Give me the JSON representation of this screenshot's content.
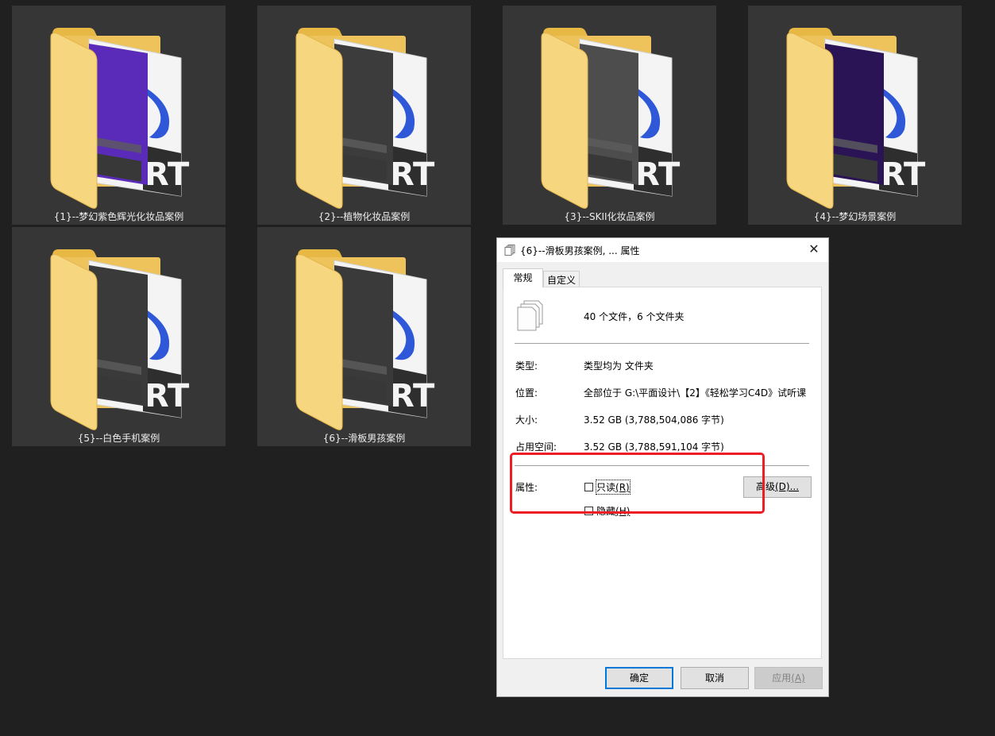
{
  "folders": [
    {
      "name": "{1}--梦幻紫色辉光化妆品案例"
    },
    {
      "name": "{2}--植物化妆品案例"
    },
    {
      "name": "{3}--SKII化妆品案例"
    },
    {
      "name": "{4}--梦幻场景案例"
    },
    {
      "name": "{5}--白色手机案例"
    },
    {
      "name": "{6}--滑板男孩案例"
    }
  ],
  "dialog": {
    "title": "{6}--滑板男孩案例, ... 属性",
    "close_glyph": "✕",
    "tabs": [
      {
        "label": "常规",
        "active": true
      },
      {
        "label": "自定义",
        "active": false
      }
    ],
    "summary": "40 个文件，6 个文件夹",
    "type_label": "类型:",
    "type_value": "类型均为 文件夹",
    "location_label": "位置:",
    "location_value": "全部位于 G:\\平面设计\\【2】《轻松学习C4D》试听课",
    "size_label": "大小:",
    "size_value": "3.52 GB (3,788,504,086 字节)",
    "disk_label": "占用空间:",
    "disk_value": "3.52 GB (3,788,591,104 字节)",
    "attributes_label": "属性:",
    "readonly_text": "只读",
    "readonly_key": "(R)",
    "hidden_text": "隐藏",
    "hidden_key": "(H)",
    "advanced_text": "高级",
    "advanced_key": "(D)...",
    "ok_label": "确定",
    "cancel_label": "取消",
    "apply_text": "应用",
    "apply_key": "(A)",
    "highlight_color": "#ee1c25"
  }
}
